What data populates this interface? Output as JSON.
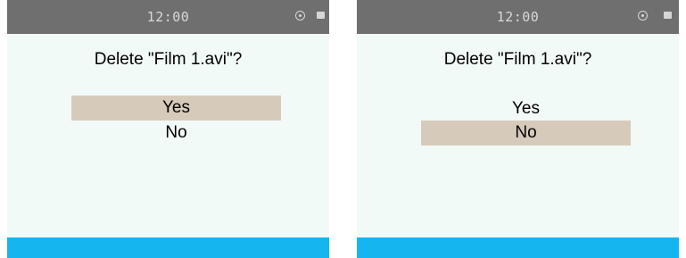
{
  "colors": {
    "status_bar": "#6f6f6f",
    "screen_background": "#f2faf8",
    "selection_highlight": "#d6cbbb",
    "bottom_bar": "#15b6f0",
    "status_text": "#d8d8d8"
  },
  "screens": [
    {
      "status_bar": {
        "time": "12:00",
        "icons": [
          "target-icon",
          "battery-icon"
        ]
      },
      "dialog": {
        "title": "Delete \"Film 1.avi\"?",
        "options": [
          {
            "label": "Yes",
            "selected": true
          },
          {
            "label": "No",
            "selected": false
          }
        ]
      }
    },
    {
      "status_bar": {
        "time": "12:00",
        "icons": [
          "target-icon",
          "battery-icon"
        ]
      },
      "dialog": {
        "title": "Delete \"Film 1.avi\"?",
        "options": [
          {
            "label": "Yes",
            "selected": false
          },
          {
            "label": "No",
            "selected": true
          }
        ]
      }
    }
  ]
}
